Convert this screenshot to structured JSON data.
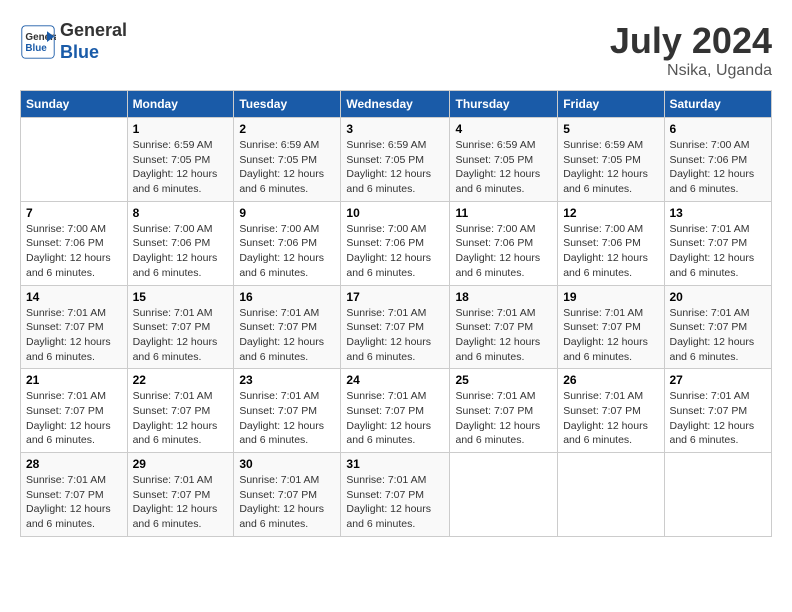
{
  "header": {
    "logo_line1": "General",
    "logo_line2": "Blue",
    "month_year": "July 2024",
    "location": "Nsika, Uganda"
  },
  "days_of_week": [
    "Sunday",
    "Monday",
    "Tuesday",
    "Wednesday",
    "Thursday",
    "Friday",
    "Saturday"
  ],
  "weeks": [
    [
      {
        "day": "",
        "info": ""
      },
      {
        "day": "1",
        "info": "Sunrise: 6:59 AM\nSunset: 7:05 PM\nDaylight: 12 hours\nand 6 minutes."
      },
      {
        "day": "2",
        "info": "Sunrise: 6:59 AM\nSunset: 7:05 PM\nDaylight: 12 hours\nand 6 minutes."
      },
      {
        "day": "3",
        "info": "Sunrise: 6:59 AM\nSunset: 7:05 PM\nDaylight: 12 hours\nand 6 minutes."
      },
      {
        "day": "4",
        "info": "Sunrise: 6:59 AM\nSunset: 7:05 PM\nDaylight: 12 hours\nand 6 minutes."
      },
      {
        "day": "5",
        "info": "Sunrise: 6:59 AM\nSunset: 7:05 PM\nDaylight: 12 hours\nand 6 minutes."
      },
      {
        "day": "6",
        "info": "Sunrise: 7:00 AM\nSunset: 7:06 PM\nDaylight: 12 hours\nand 6 minutes."
      }
    ],
    [
      {
        "day": "7",
        "info": "Sunrise: 7:00 AM\nSunset: 7:06 PM\nDaylight: 12 hours\nand 6 minutes."
      },
      {
        "day": "8",
        "info": "Sunrise: 7:00 AM\nSunset: 7:06 PM\nDaylight: 12 hours\nand 6 minutes."
      },
      {
        "day": "9",
        "info": "Sunrise: 7:00 AM\nSunset: 7:06 PM\nDaylight: 12 hours\nand 6 minutes."
      },
      {
        "day": "10",
        "info": "Sunrise: 7:00 AM\nSunset: 7:06 PM\nDaylight: 12 hours\nand 6 minutes."
      },
      {
        "day": "11",
        "info": "Sunrise: 7:00 AM\nSunset: 7:06 PM\nDaylight: 12 hours\nand 6 minutes."
      },
      {
        "day": "12",
        "info": "Sunrise: 7:00 AM\nSunset: 7:06 PM\nDaylight: 12 hours\nand 6 minutes."
      },
      {
        "day": "13",
        "info": "Sunrise: 7:01 AM\nSunset: 7:07 PM\nDaylight: 12 hours\nand 6 minutes."
      }
    ],
    [
      {
        "day": "14",
        "info": "Sunrise: 7:01 AM\nSunset: 7:07 PM\nDaylight: 12 hours\nand 6 minutes."
      },
      {
        "day": "15",
        "info": "Sunrise: 7:01 AM\nSunset: 7:07 PM\nDaylight: 12 hours\nand 6 minutes."
      },
      {
        "day": "16",
        "info": "Sunrise: 7:01 AM\nSunset: 7:07 PM\nDaylight: 12 hours\nand 6 minutes."
      },
      {
        "day": "17",
        "info": "Sunrise: 7:01 AM\nSunset: 7:07 PM\nDaylight: 12 hours\nand 6 minutes."
      },
      {
        "day": "18",
        "info": "Sunrise: 7:01 AM\nSunset: 7:07 PM\nDaylight: 12 hours\nand 6 minutes."
      },
      {
        "day": "19",
        "info": "Sunrise: 7:01 AM\nSunset: 7:07 PM\nDaylight: 12 hours\nand 6 minutes."
      },
      {
        "day": "20",
        "info": "Sunrise: 7:01 AM\nSunset: 7:07 PM\nDaylight: 12 hours\nand 6 minutes."
      }
    ],
    [
      {
        "day": "21",
        "info": "Sunrise: 7:01 AM\nSunset: 7:07 PM\nDaylight: 12 hours\nand 6 minutes."
      },
      {
        "day": "22",
        "info": "Sunrise: 7:01 AM\nSunset: 7:07 PM\nDaylight: 12 hours\nand 6 minutes."
      },
      {
        "day": "23",
        "info": "Sunrise: 7:01 AM\nSunset: 7:07 PM\nDaylight: 12 hours\nand 6 minutes."
      },
      {
        "day": "24",
        "info": "Sunrise: 7:01 AM\nSunset: 7:07 PM\nDaylight: 12 hours\nand 6 minutes."
      },
      {
        "day": "25",
        "info": "Sunrise: 7:01 AM\nSunset: 7:07 PM\nDaylight: 12 hours\nand 6 minutes."
      },
      {
        "day": "26",
        "info": "Sunrise: 7:01 AM\nSunset: 7:07 PM\nDaylight: 12 hours\nand 6 minutes."
      },
      {
        "day": "27",
        "info": "Sunrise: 7:01 AM\nSunset: 7:07 PM\nDaylight: 12 hours\nand 6 minutes."
      }
    ],
    [
      {
        "day": "28",
        "info": "Sunrise: 7:01 AM\nSunset: 7:07 PM\nDaylight: 12 hours\nand 6 minutes."
      },
      {
        "day": "29",
        "info": "Sunrise: 7:01 AM\nSunset: 7:07 PM\nDaylight: 12 hours\nand 6 minutes."
      },
      {
        "day": "30",
        "info": "Sunrise: 7:01 AM\nSunset: 7:07 PM\nDaylight: 12 hours\nand 6 minutes."
      },
      {
        "day": "31",
        "info": "Sunrise: 7:01 AM\nSunset: 7:07 PM\nDaylight: 12 hours\nand 6 minutes."
      },
      {
        "day": "",
        "info": ""
      },
      {
        "day": "",
        "info": ""
      },
      {
        "day": "",
        "info": ""
      }
    ]
  ]
}
